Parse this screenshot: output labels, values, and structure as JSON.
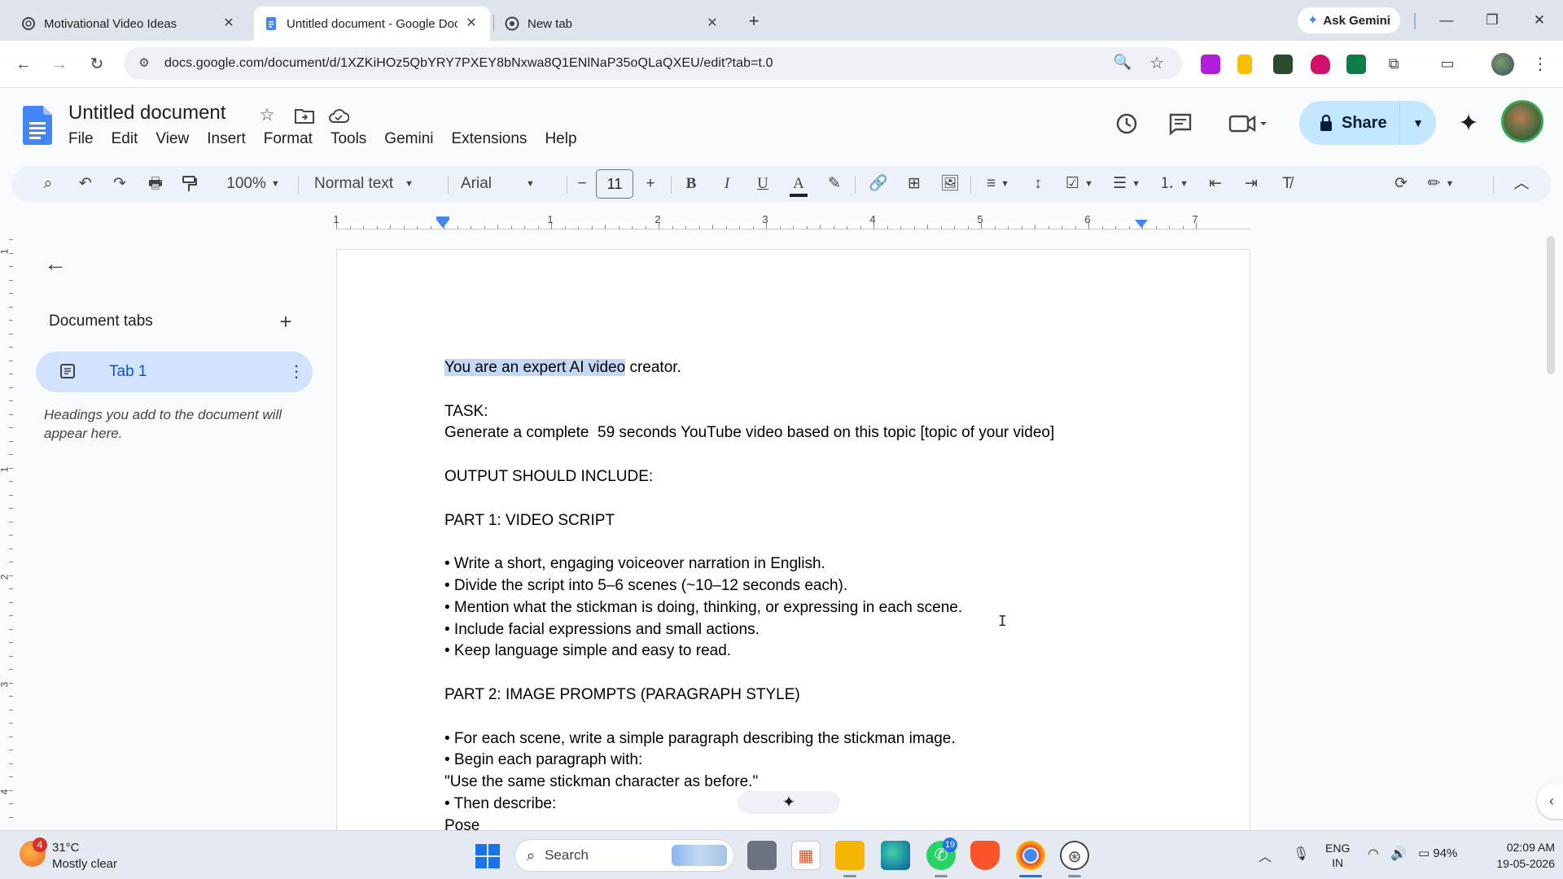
{
  "browser": {
    "tabs": [
      {
        "title": "Motivational Video Ideas",
        "icon": "openai-icon",
        "active": false
      },
      {
        "title": "Untitled document - Google Docs",
        "icon": "docs-icon",
        "active": true
      },
      {
        "title": "New tab",
        "icon": "chrome-icon",
        "active": false
      }
    ],
    "ask_gemini_label": "Ask Gemini",
    "url": "docs.google.com/document/d/1XZKiHOz5QbYRY7PXEY8bNxwa8Q1ENlNaP35oQLaQXEU/edit?tab=t.0"
  },
  "docs": {
    "title": "Untitled document",
    "menu": [
      "File",
      "Edit",
      "View",
      "Insert",
      "Format",
      "Tools",
      "Gemini",
      "Extensions",
      "Help"
    ],
    "share_label": "Share",
    "toolbar": {
      "zoom": "100%",
      "style": "Normal text",
      "font": "Arial",
      "font_size": "11"
    },
    "ruler_numbers": [
      "1",
      "1",
      "2",
      "3",
      "4",
      "5",
      "6",
      "7"
    ],
    "vruler_numbers": [
      "1",
      "1",
      "2",
      "3",
      "4"
    ]
  },
  "sidebar": {
    "title": "Document tabs",
    "tab_label": "Tab 1",
    "hint": "Headings you add to the document will appear here."
  },
  "document": {
    "selected_text": "You are an expert AI video",
    "first_line_rest": " creator.",
    "lines": [
      "",
      "TASK:",
      "Generate a complete  59 seconds YouTube video based on this topic [topic of your video]",
      "",
      "OUTPUT SHOULD INCLUDE:",
      "",
      "PART 1: VIDEO SCRIPT",
      "",
      "• Write a short, engaging voiceover narration in English.",
      "• Divide the script into 5–6 scenes (~10–12 seconds each).",
      "• Mention what the stickman is doing, thinking, or expressing in each scene.",
      "• Include facial expressions and small actions.",
      "• Keep language simple and easy to read.",
      "",
      "PART 2: IMAGE PROMPTS (PARAGRAPH STYLE)",
      "",
      "• For each scene, write a simple paragraph describing the stickman image.",
      "• Begin each paragraph with:",
      "\"Use the same stickman character as before.\"",
      "• Then describe:",
      "Pose"
    ]
  },
  "taskbar": {
    "weather_temp": "31°C",
    "weather_desc": "Mostly clear",
    "weather_badge": "4",
    "search_label": "Search",
    "whatsapp_badge": "19",
    "lang_top": "ENG",
    "lang_bottom": "IN",
    "battery": "94%",
    "time": "02:09 AM",
    "date": "19-05-2026"
  },
  "colors": {
    "accent": "#0b57d0",
    "share_bg": "#c2e7ff",
    "selection": "#c3d7f7"
  }
}
